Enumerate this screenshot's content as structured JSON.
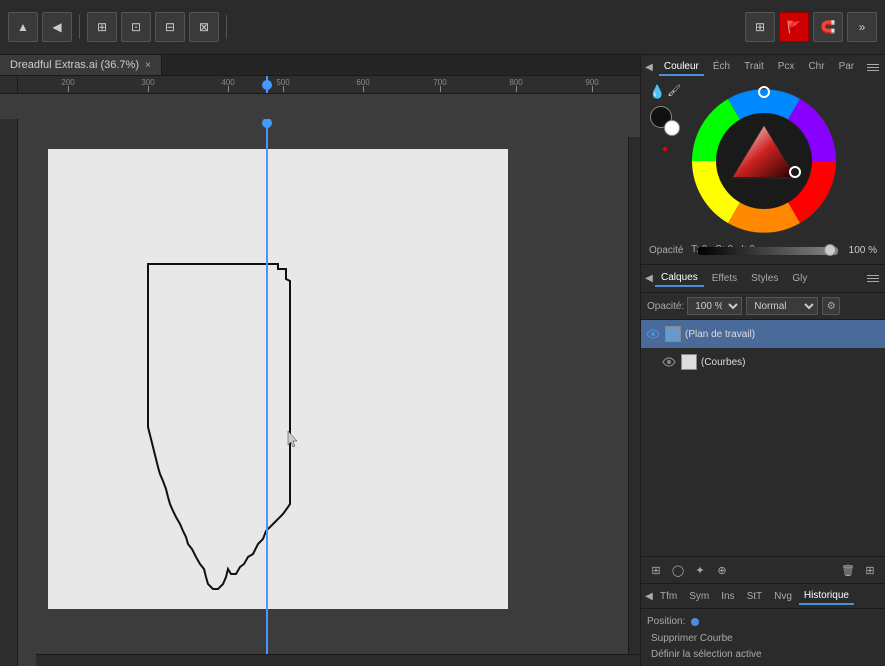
{
  "toolbar": {
    "buttons": [
      "▲",
      "◀",
      "⊞",
      "⊡",
      "⊟",
      "⊠"
    ],
    "right_buttons": [
      "⊞",
      "🔴",
      "🧲"
    ]
  },
  "document": {
    "title": "Dreadful Extras.ai (36.7%)",
    "close_label": "×"
  },
  "ruler": {
    "ticks": [
      "200",
      "300",
      "400",
      "500",
      "600",
      "700",
      "800",
      "900"
    ]
  },
  "color_panel": {
    "tabs": [
      "Couleur",
      "Éch",
      "Trait",
      "Pcx",
      "Chr",
      "Par"
    ],
    "active_tab": "Couleur",
    "tsi": {
      "t": "T: 0",
      "s": "S: 0",
      "i": "I: 0"
    },
    "opacity_label": "Opacité",
    "opacity_value": "100 %"
  },
  "layers_panel": {
    "tabs": [
      "Calques",
      "Effets",
      "Styles",
      "Gly"
    ],
    "active_tab": "Calques",
    "opacity_label": "Opacité:",
    "opacity_value": "100 %",
    "blend_mode": "Normal",
    "layers": [
      {
        "name": "(Plan de travail)",
        "selected": true,
        "visible": true,
        "indent": 0
      },
      {
        "name": "(Courbes)",
        "selected": false,
        "visible": true,
        "indent": 1
      }
    ]
  },
  "transform_panel": {
    "tabs": [
      "Tfm",
      "Sym",
      "Ins",
      "StT",
      "Nvg",
      "Historique"
    ],
    "active_tab": "Historique",
    "position_label": "Position:",
    "actions": [
      "Supprimer Courbe",
      "Définir la sélection active"
    ]
  }
}
